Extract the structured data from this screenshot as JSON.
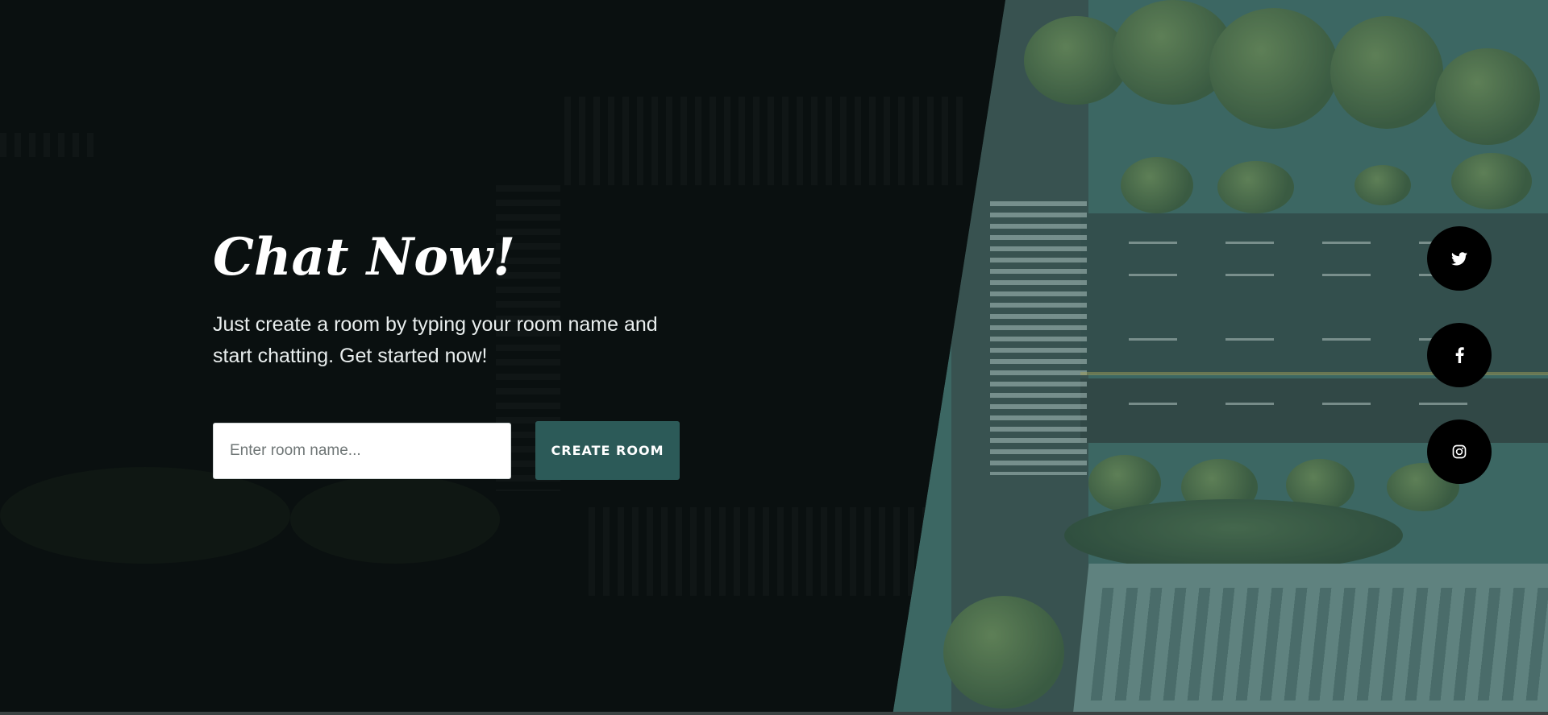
{
  "hero": {
    "title": "Chat Now!",
    "description": "Just create a room by typing your room name and start chatting. Get started now!"
  },
  "form": {
    "input_placeholder": "Enter room name...",
    "input_value": "",
    "button_label": "CREATE ROOM"
  },
  "social": {
    "items": [
      {
        "icon": "twitter-icon"
      },
      {
        "icon": "facebook-icon"
      },
      {
        "icon": "instagram-icon"
      }
    ]
  },
  "colors": {
    "accent": "#2c5a58",
    "background_dark": "#0a1010",
    "photo_tint": "#3f6a66",
    "social_bg": "#000000"
  }
}
